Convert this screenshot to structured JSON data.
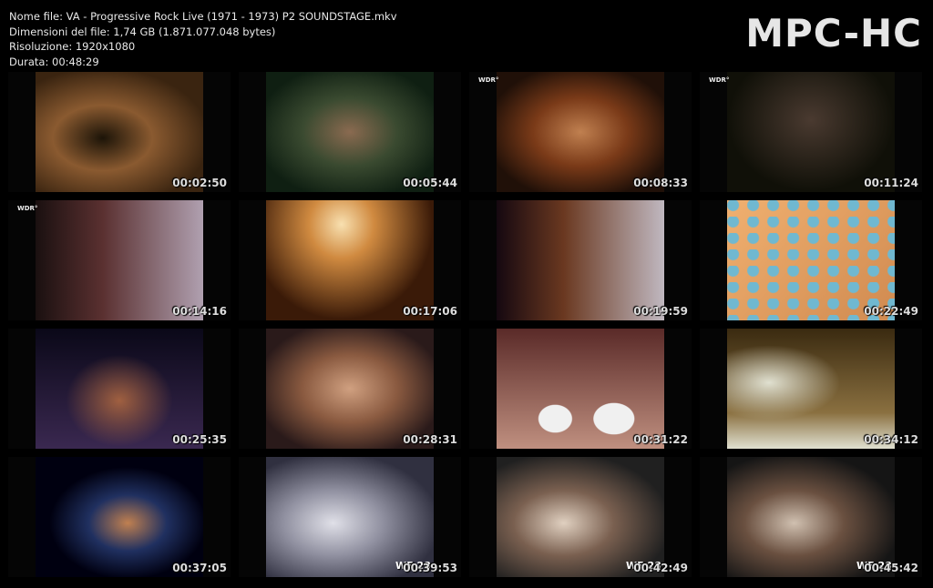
{
  "file_info": {
    "name_line": "Nome file: VA - Progressive Rock Live (1971 - 1973) P2 SOUNDSTAGE.mkv",
    "size_line": "Dimensioni del file: 1,74 GB (1.871.077.048 bytes)",
    "resolution_line": "Risoluzione: 1920x1080",
    "duration_line": "Durata: 00:48:29"
  },
  "logo": "MPC-HC",
  "thumbnails": [
    {
      "time": "00:02:50",
      "badge": "",
      "overlay": "",
      "colors": [
        "#3a2410",
        "#8a5a30",
        "#1c1408"
      ],
      "style": "guitar"
    },
    {
      "time": "00:05:44",
      "badge": "",
      "overlay": "",
      "colors": [
        "#0f1f12",
        "#3a4a30",
        "#8a6a50"
      ],
      "style": "singer"
    },
    {
      "time": "00:08:33",
      "badge": "WDR°",
      "overlay": "",
      "colors": [
        "#201008",
        "#7a3a18",
        "#c08050"
      ],
      "style": "singer"
    },
    {
      "time": "00:11:24",
      "badge": "WDR°",
      "overlay": "",
      "colors": [
        "#101008",
        "#4a3a30",
        "#8a7a60"
      ],
      "style": "dark"
    },
    {
      "time": "00:14:16",
      "badge": "WDR°",
      "overlay": "",
      "colors": [
        "#1a1010",
        "#5a3030",
        "#b0a0b0"
      ],
      "style": "keys"
    },
    {
      "time": "00:17:06",
      "badge": "",
      "overlay": "",
      "colors": [
        "#3a1a08",
        "#d08a40",
        "#f8e0b0"
      ],
      "style": "cymbal"
    },
    {
      "time": "00:19:59",
      "badge": "",
      "overlay": "",
      "colors": [
        "#150810",
        "#6a3820",
        "#c0b8c0"
      ],
      "style": "keys"
    },
    {
      "time": "00:22:49",
      "badge": "",
      "overlay": "",
      "colors": [
        "#d08a50",
        "#f0b070",
        "#70b8d0"
      ],
      "style": "pattern"
    },
    {
      "time": "00:25:35",
      "badge": "",
      "overlay": "",
      "colors": [
        "#0a0818",
        "#3a2850",
        "#a06040"
      ],
      "style": "band"
    },
    {
      "time": "00:28:31",
      "badge": "",
      "overlay": "",
      "colors": [
        "#2a1a1a",
        "#8a5a40",
        "#d0a080"
      ],
      "style": "singer"
    },
    {
      "time": "00:31:22",
      "badge": "",
      "overlay": "",
      "colors": [
        "#5a2a28",
        "#c09080",
        "#f0f0f0"
      ],
      "style": "drums"
    },
    {
      "time": "00:34:12",
      "badge": "",
      "overlay": "",
      "colors": [
        "#3a2a10",
        "#8a7040",
        "#e0e0d0"
      ],
      "style": "stage"
    },
    {
      "time": "00:37:05",
      "badge": "",
      "overlay": "",
      "colors": [
        "#000010",
        "#203060",
        "#c08050"
      ],
      "style": "cymbal-dark"
    },
    {
      "time": "00:39:53",
      "badge": "",
      "overlay": "WF 28",
      "colors": [
        "#303040",
        "#9090a0",
        "#e0e0e8"
      ],
      "style": "guitar"
    },
    {
      "time": "00:42:49",
      "badge": "",
      "overlay": "WF 28",
      "colors": [
        "#202020",
        "#7a6050",
        "#e0d0c0"
      ],
      "style": "guitar"
    },
    {
      "time": "00:45:42",
      "badge": "",
      "overlay": "WF 28",
      "colors": [
        "#151515",
        "#6a5040",
        "#d0c0b0"
      ],
      "style": "guitar"
    }
  ]
}
